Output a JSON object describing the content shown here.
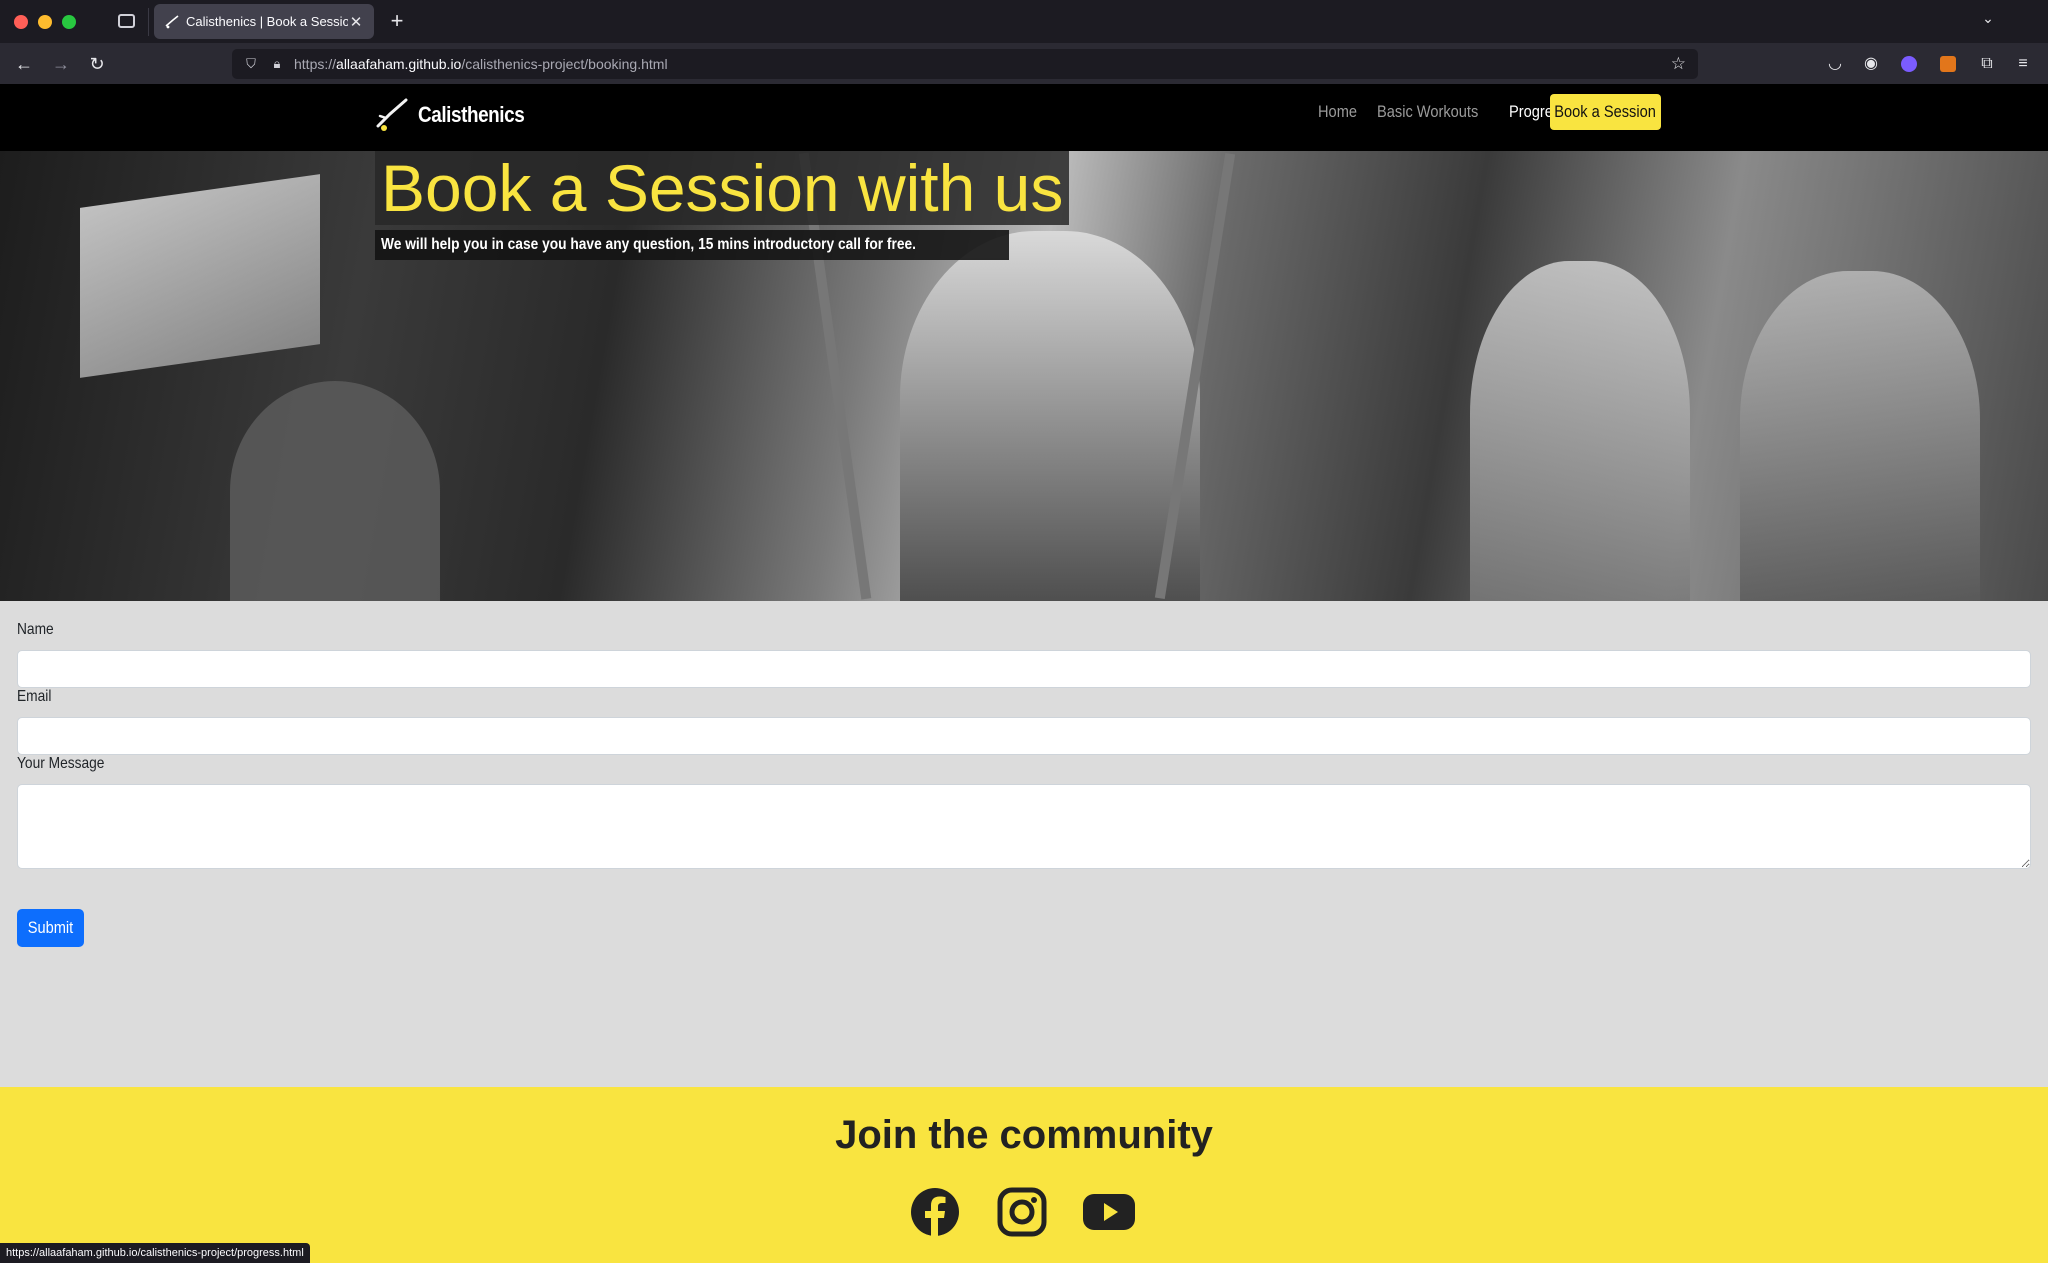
{
  "browser": {
    "tab_title": "Calisthenics | Book a Session",
    "url_scheme": "https://",
    "url_host": "allaafaham.github.io",
    "url_path": "/calisthenics-project/booking.html",
    "status_url": "https://allaafaham.github.io/calisthenics-project/progress.html"
  },
  "site": {
    "brand": "Calisthenics",
    "nav": [
      {
        "label": "Home"
      },
      {
        "label": "Basic Workouts"
      },
      {
        "label": "Progress"
      }
    ],
    "cta_label": "Book a Session"
  },
  "hero": {
    "title": "Book a Session with us",
    "subtitle": "We will help you in case you have any question, 15 mins introductory call for free."
  },
  "form": {
    "name_label": "Name",
    "name_value": "",
    "email_label": "Email",
    "email_value": "",
    "message_label": "Your Message",
    "message_value": "",
    "submit_label": "Submit"
  },
  "footer": {
    "title": "Join the community"
  },
  "colors": {
    "brand_yellow": "#f9e440",
    "submit_blue": "#0d6efd",
    "nav_black": "#000000",
    "page_gray": "#dcdcdc"
  },
  "icons": [
    "facebook-icon",
    "instagram-icon",
    "youtube-icon",
    "star-icon",
    "lock-icon",
    "shield-icon"
  ]
}
